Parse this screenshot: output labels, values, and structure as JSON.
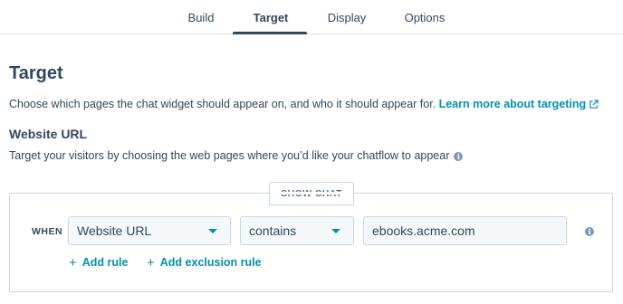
{
  "tabs": [
    {
      "label": "Build"
    },
    {
      "label": "Target"
    },
    {
      "label": "Display"
    },
    {
      "label": "Options"
    }
  ],
  "header": {
    "title": "Target"
  },
  "description": {
    "text": "Choose which pages the chat widget should appear on, and who it should appear for.",
    "link_text": "Learn more about targeting",
    "link_icon": "external-link-icon"
  },
  "website_url": {
    "title": "Website URL",
    "description": "Target your visitors by choosing the web pages where you’d like your chatflow to appear",
    "info_icon": "info-icon"
  },
  "rules": {
    "group_label": "SHOW CHAT",
    "when_label": "WHEN",
    "field_select": "Website URL",
    "operator_select": "contains",
    "value": "ebooks.acme.com",
    "add_rule": "Add rule",
    "add_exclusion_rule": "Add exclusion rule"
  },
  "colors": {
    "text": "#33475b",
    "link": "#0091ae",
    "border": "#cbd6e2",
    "field_bg": "#f5f8fa"
  }
}
